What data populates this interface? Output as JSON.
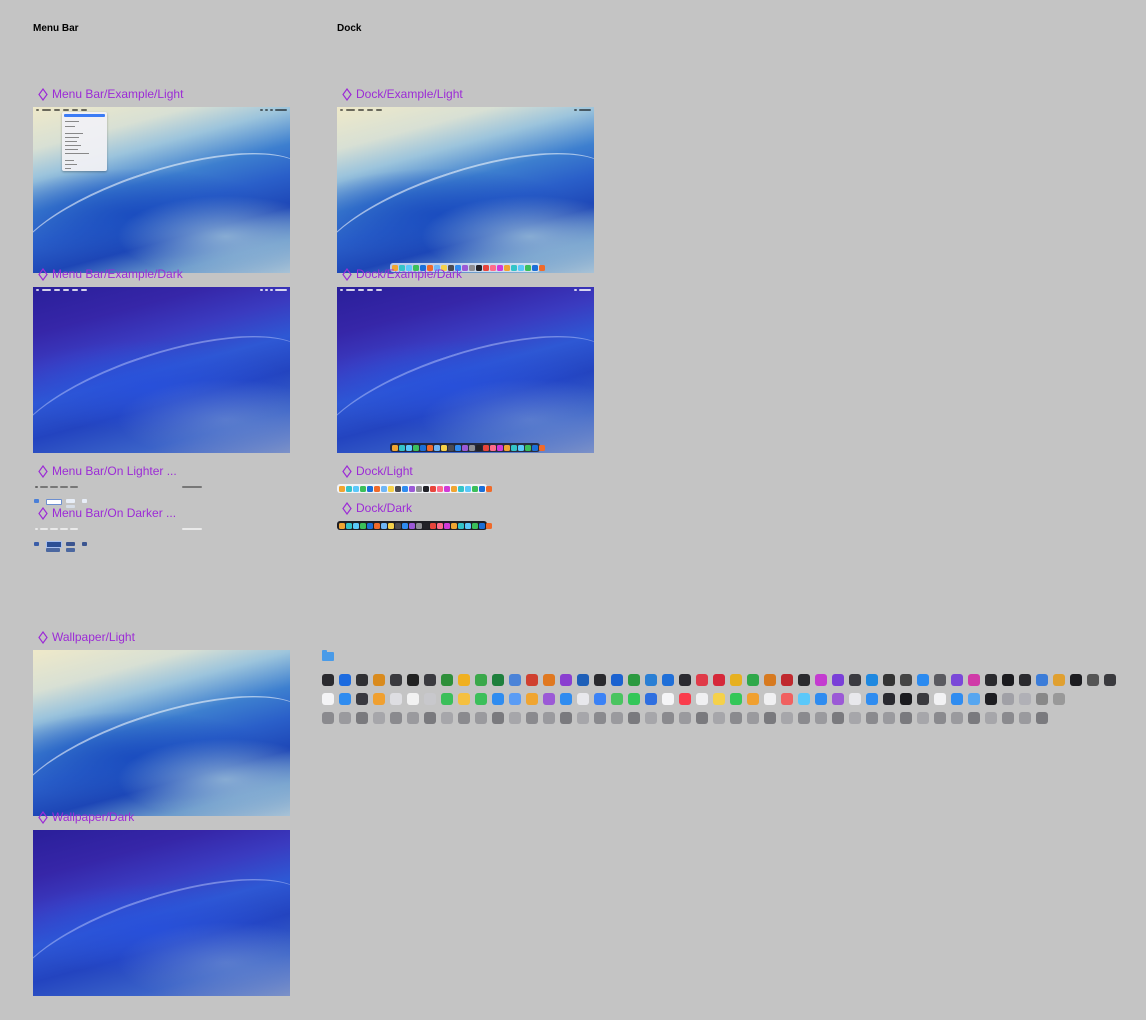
{
  "sections": {
    "menu_bar": "Menu Bar",
    "dock": "Dock"
  },
  "components": {
    "menu_bar_example_light": "Menu Bar/Example/Light",
    "menu_bar_example_dark": "Menu Bar/Example/Dark",
    "menu_bar_on_lighter": "Menu Bar/On Lighter ...",
    "menu_bar_on_darker": "Menu Bar/On Darker ...",
    "dock_example_light": "Dock/Example/Light",
    "dock_example_dark": "Dock/Example/Dark",
    "dock_light": "Dock/Light",
    "dock_dark": "Dock/Dark",
    "wallpaper_light": "Wallpaper/Light",
    "wallpaper_dark": "Wallpaper/Dark"
  },
  "colors": {
    "canvas": "#c4c4c4",
    "component_label": "#9c2bd6",
    "accent_blue": "#3b7cf5"
  },
  "icons": {
    "component": "component-diamond-icon",
    "folder": "folder-icon"
  }
}
